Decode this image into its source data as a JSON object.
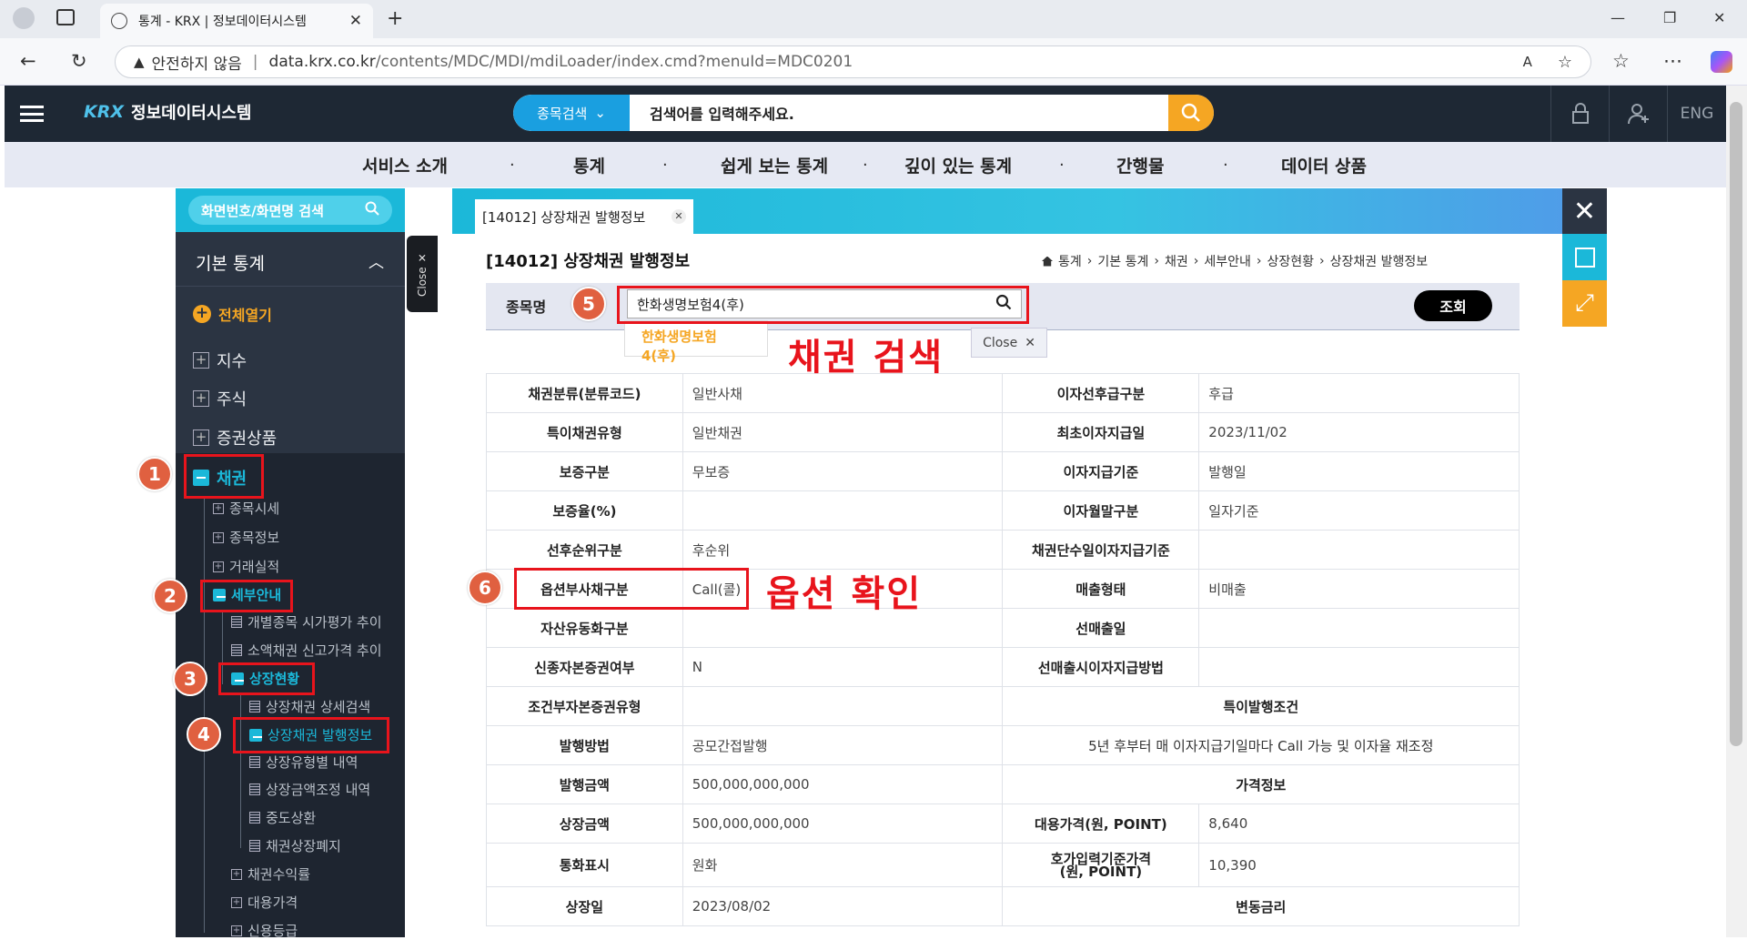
{
  "browser": {
    "tab_title": "통계 - KRX | 정보데이터시스템",
    "new_tab": "+",
    "security_label": "안전하지 않음",
    "url_host": "data.krx.co.kr",
    "url_path": "/contents/MDC/MDI/mdiLoader/index.cmd?menuId=MDC0201"
  },
  "header": {
    "logo": "KRX",
    "site_name": "정보데이터시스템",
    "search_type": "종목검색",
    "search_placeholder": "검색어를 입력해주세요.",
    "lang": "ENG"
  },
  "gnb": [
    "서비스 소개",
    "통계",
    "쉽게 보는 통계",
    "깊이 있는 통계",
    "간행물",
    "데이터 상품"
  ],
  "sidebar": {
    "search_label": "화면번호/화면명 검색",
    "title": "기본 통계",
    "expand_all": "전체열기",
    "close_label": "Close",
    "items": {
      "index": "지수",
      "stock": "주식",
      "securities": "증권상품",
      "bond": "채권",
      "bond_quote": "종목시세",
      "bond_info": "종목정보",
      "bond_trade": "거래실적",
      "detail": "세부안내",
      "fair_price": "개별종목 시가평가 추이",
      "small_bond": "소액채권 신고가격 추이",
      "listing": "상장현황",
      "listing_search": "상장채권 상세검색",
      "listing_issue": "상장채권 발행정보",
      "listing_type": "상장유형별 내역",
      "listing_amount": "상장금액조정 내역",
      "redemption": "중도상환",
      "delisting": "채권상장폐지",
      "yield": "채권수익률",
      "subst_price": "대용가격",
      "credit": "신용등급"
    }
  },
  "content": {
    "tab_label": "[14012] 상장채권 발행정보",
    "page_title": "[14012] 상장채권 발행정보",
    "breadcrumb": [
      "통계",
      "기본 통계",
      "채권",
      "세부안내",
      "상장현황",
      "상장채권 발행정보"
    ],
    "filter_label": "종목명",
    "filter_value": "한화생명보험4(후)",
    "filter_button": "조회",
    "suggestion": "한화생명보험4(후)",
    "suggestion_close": "Close"
  },
  "table": [
    [
      "채권분류(분류코드)",
      "일반사채",
      "이자선후급구분",
      "후급"
    ],
    [
      "특이채권유형",
      "일반채권",
      "최초이자지급일",
      "2023/11/02"
    ],
    [
      "보증구분",
      "무보증",
      "이자지급기준",
      "발행일"
    ],
    [
      "보증율(%)",
      "",
      "이자월말구분",
      "일자기준"
    ],
    [
      "선후순위구분",
      "후순위",
      "채권단수일이자지급기준",
      ""
    ],
    [
      "옵션부사채구분",
      "Call(콜)",
      "매출형태",
      "비매출"
    ],
    [
      "자산유동화구분",
      "",
      "선매출일",
      ""
    ],
    [
      "신종자본증권여부",
      "N",
      "선매출시이자지급방법",
      ""
    ]
  ],
  "table_b": {
    "cond_label": "조건부자본증권유형",
    "special_header": "특이발행조건",
    "method_label": "발행방법",
    "method_value": "공모간접발행",
    "special_value": "5년 후부터 매 이자지급기일마다 Call 가능 및 이자율 재조정",
    "issue_amt_label": "발행금액",
    "issue_amt_value": "500,000,000,000",
    "price_header": "가격정보",
    "list_amt_label": "상장금액",
    "list_amt_value": "500,000,000,000",
    "subst_label": "대용가격(원, POINT)",
    "subst_value": "8,640",
    "currency_label": "통화표시",
    "currency_value": "원화",
    "quote_label_1": "호가입력기준가격",
    "quote_label_2": "(원, POINT)",
    "quote_value": "10,390",
    "list_date_label": "상장일",
    "list_date_value": "2023/08/02",
    "floating_header": "변동금리"
  },
  "annotations": {
    "n1": "1",
    "n2": "2",
    "n3": "3",
    "n4": "4",
    "n5": "5",
    "n6": "6",
    "bond_search": "채권 검색",
    "option_check": "옵션 확인"
  },
  "colors": {
    "accent": "#1bb8d9",
    "orange": "#f5a623",
    "annotation_red": "#e8141c",
    "header_bg": "#1e2834"
  }
}
